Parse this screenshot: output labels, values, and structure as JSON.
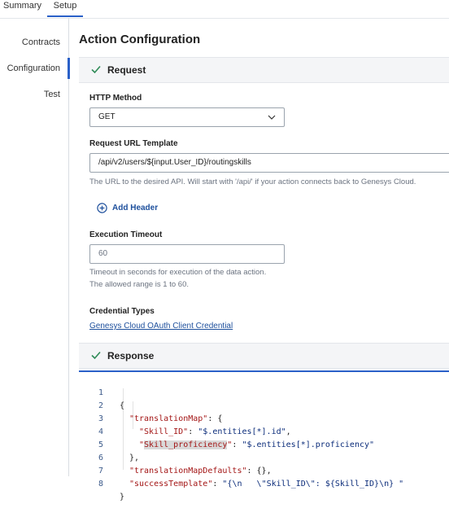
{
  "tabs": [
    {
      "label": "Summary"
    },
    {
      "label": "Setup"
    }
  ],
  "sidenav": {
    "items": [
      {
        "label": "Contracts"
      },
      {
        "label": "Configuration"
      },
      {
        "label": "Test"
      }
    ]
  },
  "page_title": "Action Configuration",
  "request": {
    "section_label": "Request",
    "http_method_label": "HTTP Method",
    "http_method_value": "GET",
    "url_label": "Request URL Template",
    "url_value": "/api/v2/users/${input.User_ID}/routingskills",
    "url_help": "The URL to the desired API. Will start with '/api/' if your action connects back to Genesys Cloud.",
    "add_header_label": "Add Header",
    "timeout_label": "Execution Timeout",
    "timeout_value": "60",
    "timeout_help_1": "Timeout in seconds for execution of the data action.",
    "timeout_help_2": "The allowed range is 1 to 60.",
    "credential_label": "Credential Types",
    "credential_link": "Genesys Cloud OAuth Client Credential"
  },
  "response": {
    "section_label": "Response",
    "line_numbers": [
      "1",
      "2",
      "3",
      "4",
      "5",
      "6",
      "7",
      "8"
    ],
    "lines": {
      "l1": "{",
      "l2_key": "\"translationMap\"",
      "l2_rest": ": {",
      "l3_key": "\"Skill_ID\"",
      "l3_sep": ": ",
      "l3_val": "\"$.entities[*].id\"",
      "l3_end": ",",
      "l4_q1": "\"",
      "l4_key": "Skill_proficiency",
      "l4_q2": "\"",
      "l4_sep": ": ",
      "l4_val": "\"$.entities[*].proficiency\"",
      "l5": "},",
      "l6_key": "\"translationMapDefaults\"",
      "l6_rest": ": {},",
      "l7_key": "\"successTemplate\"",
      "l7_sep": ": ",
      "l7_val": "\"{\\n   \\\"Skill_ID\\\": ${Skill_ID}\\n} \"",
      "l8": "}"
    }
  },
  "colors": {
    "accent": "#2a60c8",
    "link": "#1d4f9c",
    "check": "#2e8b57"
  }
}
